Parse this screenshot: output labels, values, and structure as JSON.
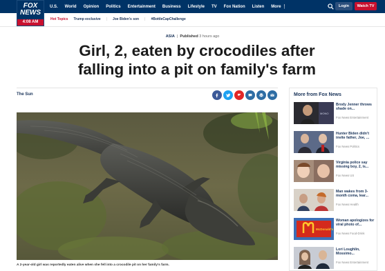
{
  "logo": {
    "line1": "FOX",
    "line2": "NEWS",
    "time": "4:08 AM"
  },
  "nav": [
    "U.S.",
    "World",
    "Opinion",
    "Politics",
    "Entertainment",
    "Business",
    "Lifestyle",
    "TV",
    "Fox Nation",
    "Listen",
    "More"
  ],
  "header_buttons": {
    "login": "Login",
    "watch": "Watch TV"
  },
  "hot_topics": {
    "label": "Hot Topics",
    "items": [
      "Trump exclusive",
      "Joe Biden's son",
      "#BottleCapChallenge"
    ]
  },
  "article": {
    "category": "ASIA",
    "published_label": "Published",
    "published_time": "3 hours ago",
    "headline": "Girl, 2, eaten by crocodiles after falling into a pit on family's farm",
    "source": "The Sun",
    "caption": "A 2-year-old girl was reportedly eaten alive when she fell into a crocodile pit on her family's farm."
  },
  "share_icons": [
    {
      "name": "facebook-icon",
      "color": "#3b5998"
    },
    {
      "name": "twitter-icon",
      "color": "#1da1f2"
    },
    {
      "name": "flipboard-icon",
      "color": "#e12828"
    },
    {
      "name": "comment-icon",
      "color": "#2e6da4"
    },
    {
      "name": "print-icon",
      "color": "#2e6da4"
    },
    {
      "name": "email-icon",
      "color": "#2e6da4"
    }
  ],
  "sidebar": {
    "title": "More from Fox News",
    "items": [
      {
        "title": "Brody Jenner throws shade on...",
        "source": "Fox News Entertainment",
        "thumb_text": "MONO"
      },
      {
        "title": "Hunter Biden didn't invite father, Joe, ...",
        "source": "Fox News Politics",
        "thumb_text": ""
      },
      {
        "title": "Virginia police say missing boy, 2, is...",
        "source": "Fox News US",
        "thumb_text": ""
      },
      {
        "title": "Man wakes from 3-month coma, lear...",
        "source": "Fox News Health",
        "thumb_text": ""
      },
      {
        "title": "Woman apologizes for viral photo of...",
        "source": "Fox News Food-Drink",
        "thumb_text": "McDonald's"
      },
      {
        "title": "Lori Loughlin, Mossimo...",
        "source": "Fox News Entertainment",
        "thumb_text": ""
      }
    ]
  }
}
